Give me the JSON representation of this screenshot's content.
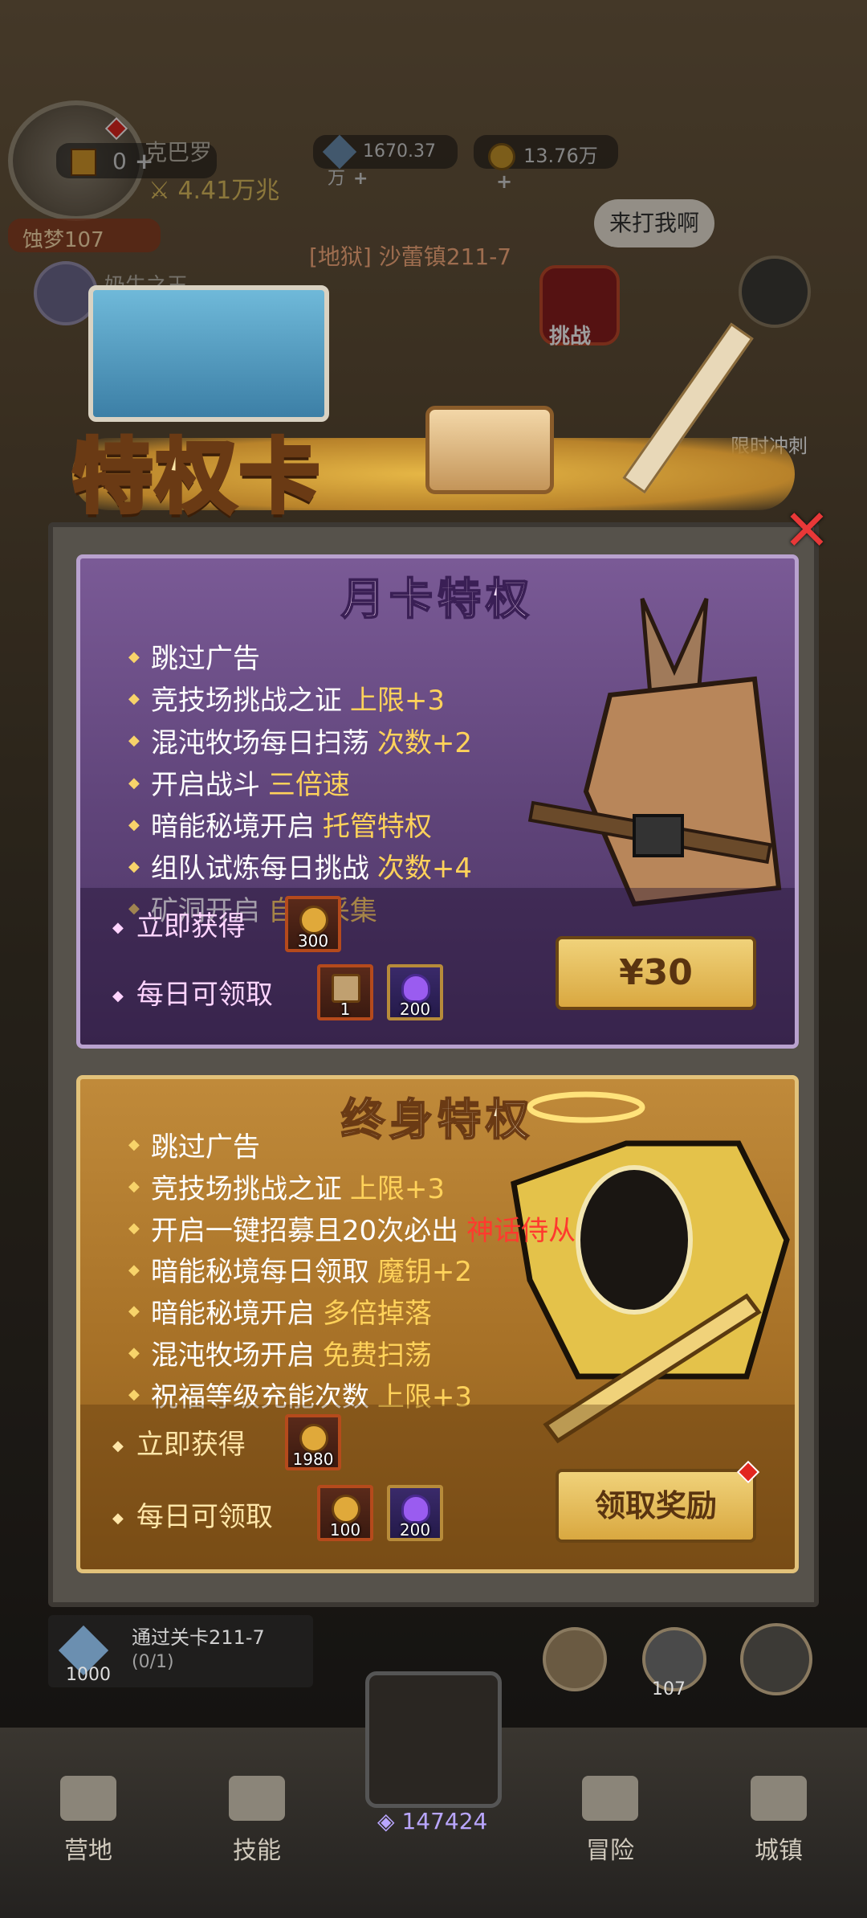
{
  "hud": {
    "ticket_count": "0",
    "player_name_partial": "克巴罗",
    "power": "4.41万兆",
    "crystals": "1670.37万",
    "gold": "13.76万",
    "dream_level": "蚀梦107",
    "second_player_partial": "奶牛之王",
    "stage_label": "[地狱] 沙蕾镇211-7",
    "speech_bubble": "来打我啊",
    "challenge_label": "挑战",
    "sprint_label": "限时冲刺"
  },
  "popup": {
    "title": "特权卡",
    "monthly": {
      "title": "月卡特权",
      "features": [
        {
          "text": "跳过广告",
          "highlight": ""
        },
        {
          "text": "竞技场挑战之证",
          "highlight": "上限+3"
        },
        {
          "text": "混沌牧场每日扫荡",
          "highlight": "次数+2"
        },
        {
          "text": "开启战斗",
          "highlight": "三倍速"
        },
        {
          "text": "暗能秘境开启",
          "highlight": "托管特权"
        },
        {
          "text": "组队试炼每日挑战",
          "highlight": "次数+4"
        },
        {
          "text": "矿洞开启",
          "highlight": "自动采集"
        }
      ],
      "instant_label": "立即获得",
      "instant_qty": "300",
      "daily_label": "每日可领取",
      "daily_qty_1": "1",
      "daily_qty_2": "200",
      "price_button": "¥30"
    },
    "lifetime": {
      "title": "终身特权",
      "features": [
        {
          "text": "跳过广告",
          "highlight": ""
        },
        {
          "text": "竞技场挑战之证",
          "highlight": "上限+3"
        },
        {
          "text": "开启一键招募且20次必出",
          "highlight": "神话侍从"
        },
        {
          "text": "暗能秘境每日领取",
          "highlight": "魔钥+2"
        },
        {
          "text": "暗能秘境开启",
          "highlight": "多倍掉落"
        },
        {
          "text": "混沌牧场开启",
          "highlight": "免费扫荡"
        },
        {
          "text": "祝福等级充能次数",
          "highlight": "上限+3"
        }
      ],
      "instant_label": "立即获得",
      "instant_qty": "1980",
      "daily_label": "每日可领取",
      "daily_qty_1": "100",
      "daily_qty_2": "200",
      "claim_button": "领取奖励"
    }
  },
  "quest": {
    "title": "通过关卡211-7",
    "progress": "(0/1)",
    "reward_qty": "1000"
  },
  "side": {
    "level_badge": "107"
  },
  "nav": {
    "camp": "营地",
    "skills": "技能",
    "center_value": "147424",
    "adventure": "冒险",
    "town": "城镇"
  },
  "colors": {
    "highlight": "#ffd25a",
    "highlight_red": "#ff3a2e",
    "purple_card": "#6a4c86",
    "gold_card": "#b07a2e",
    "close_x": "#e83838"
  }
}
